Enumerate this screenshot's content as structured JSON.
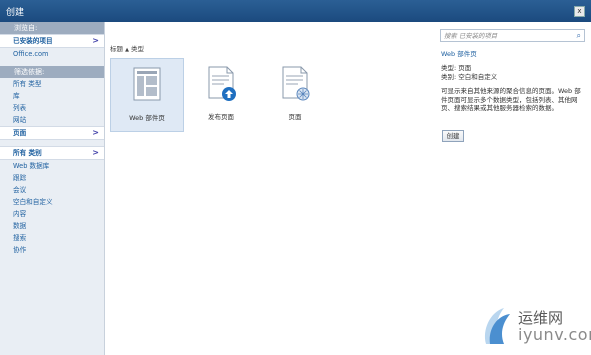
{
  "window": {
    "title": "创建",
    "close_glyph": "x"
  },
  "sidebar": {
    "browse_from_header": "浏览自:",
    "browse_items": [
      {
        "label": "已安装的项目",
        "selected": true,
        "arrow": ">"
      },
      {
        "label": "Office.com"
      }
    ],
    "filter_header": "筛选依据:",
    "filter_items": [
      {
        "label": "所有 类型"
      },
      {
        "label": "库"
      },
      {
        "label": "列表"
      },
      {
        "label": "网站"
      },
      {
        "label": "页面",
        "selected": true,
        "arrow": ">"
      }
    ],
    "category_items": [
      {
        "label": "所有 类别",
        "selected": true,
        "arrow": ">"
      },
      {
        "label": "Web 数据库"
      },
      {
        "label": "跟踪"
      },
      {
        "label": "会议"
      },
      {
        "label": "空白和自定义"
      },
      {
        "label": "内容"
      },
      {
        "label": "数据"
      },
      {
        "label": "搜索"
      },
      {
        "label": "协作"
      }
    ]
  },
  "main": {
    "sort_label": "标题",
    "sort_arrow": "▲",
    "sort_type": "类型",
    "tiles": [
      {
        "label": "Web 部件页",
        "icon": "webpart-page-icon",
        "selected": true
      },
      {
        "label": "发布页面",
        "icon": "publishing-page-icon"
      },
      {
        "label": "页面",
        "icon": "page-icon"
      }
    ]
  },
  "search": {
    "placeholder": "搜索 已安装的项目",
    "icon": "search-icon"
  },
  "detail": {
    "title": "Web 部件页",
    "type_line": "类型: 页面",
    "category_line": "类别: 空白和自定义",
    "description": "可显示来自其他来源的聚合信息的页面。Web 部件页面可显示多个数据类型，包括列表、其他网页、搜索结果或其他服务器检索的数据。",
    "create_label": "创建"
  },
  "watermark": {
    "line1": "运维网",
    "line2": "iyunv.com"
  },
  "colors": {
    "title_bar": "#1b4a7e",
    "sidebar_bg": "#e9eef4",
    "section_header": "#9dacbf",
    "link": "#1d5f9f"
  }
}
